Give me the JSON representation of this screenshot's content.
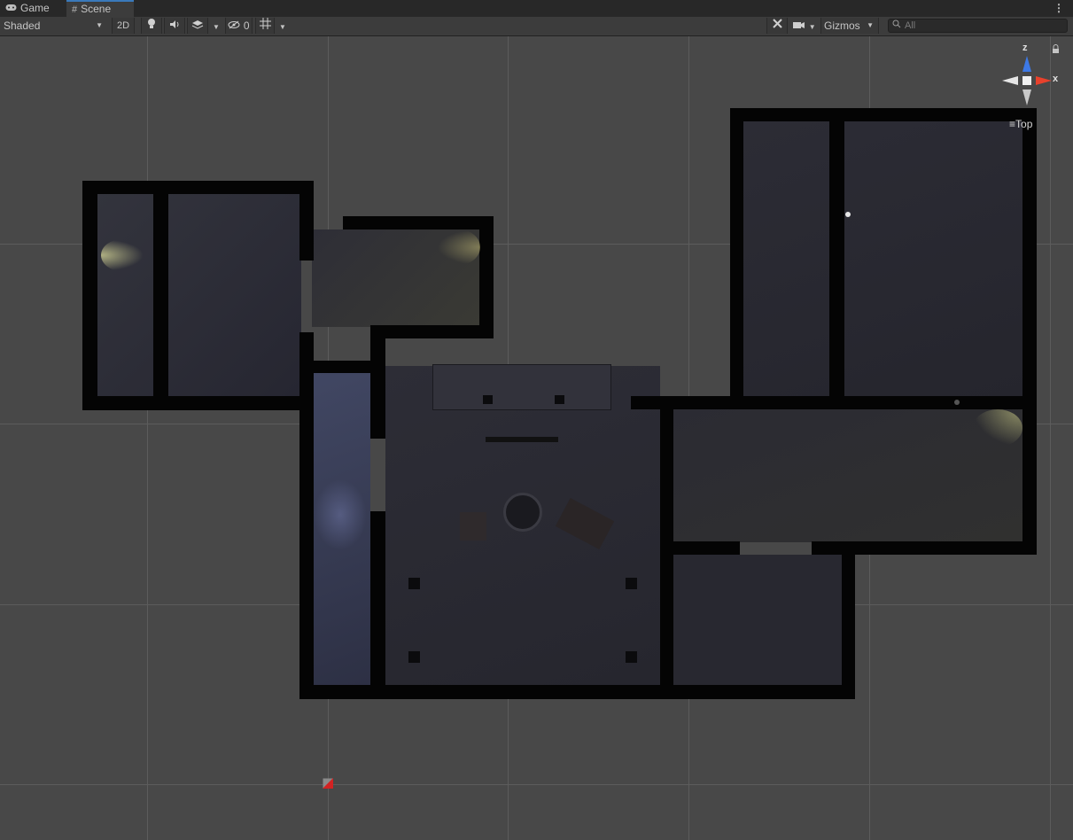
{
  "tabs": [
    {
      "label": "Game",
      "icon": "gamepad-icon"
    },
    {
      "label": "Scene",
      "icon": "hash-icon"
    }
  ],
  "toolbar": {
    "shading_mode": "Shaded",
    "toggle_2d": "2D",
    "hidden_count": "0",
    "gizmos_label": "Gizmos",
    "search_placeholder": "All"
  },
  "orientation_gizmo": {
    "view_label": "Top",
    "axis_z": "z",
    "axis_x": "x"
  },
  "colors": {
    "accent": "#3a79bb",
    "axis_x": "#e8412c",
    "axis_z": "#3d79e6",
    "scene_bg": "#484848",
    "wall": "#040404"
  }
}
